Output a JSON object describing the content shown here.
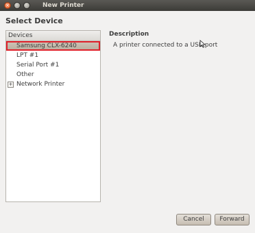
{
  "window": {
    "title": "New Printer",
    "controls": {
      "close": "×",
      "minimize": "–",
      "maximize": "+"
    }
  },
  "page": {
    "heading": "Select Device"
  },
  "devices": {
    "header": "Devices",
    "items": [
      {
        "label": "Samsung CLX-6240",
        "selected": true
      },
      {
        "label": "LPT #1"
      },
      {
        "label": "Serial Port #1"
      },
      {
        "label": "Other"
      },
      {
        "label": "Network Printer",
        "expander": "+"
      }
    ]
  },
  "description": {
    "title": "Description",
    "text": "A printer connected to a USB port"
  },
  "buttons": {
    "cancel": "Cancel",
    "forward": "Forward"
  },
  "colors": {
    "selection_outline": "#e0202a",
    "titlebar": "#3c3b37"
  }
}
